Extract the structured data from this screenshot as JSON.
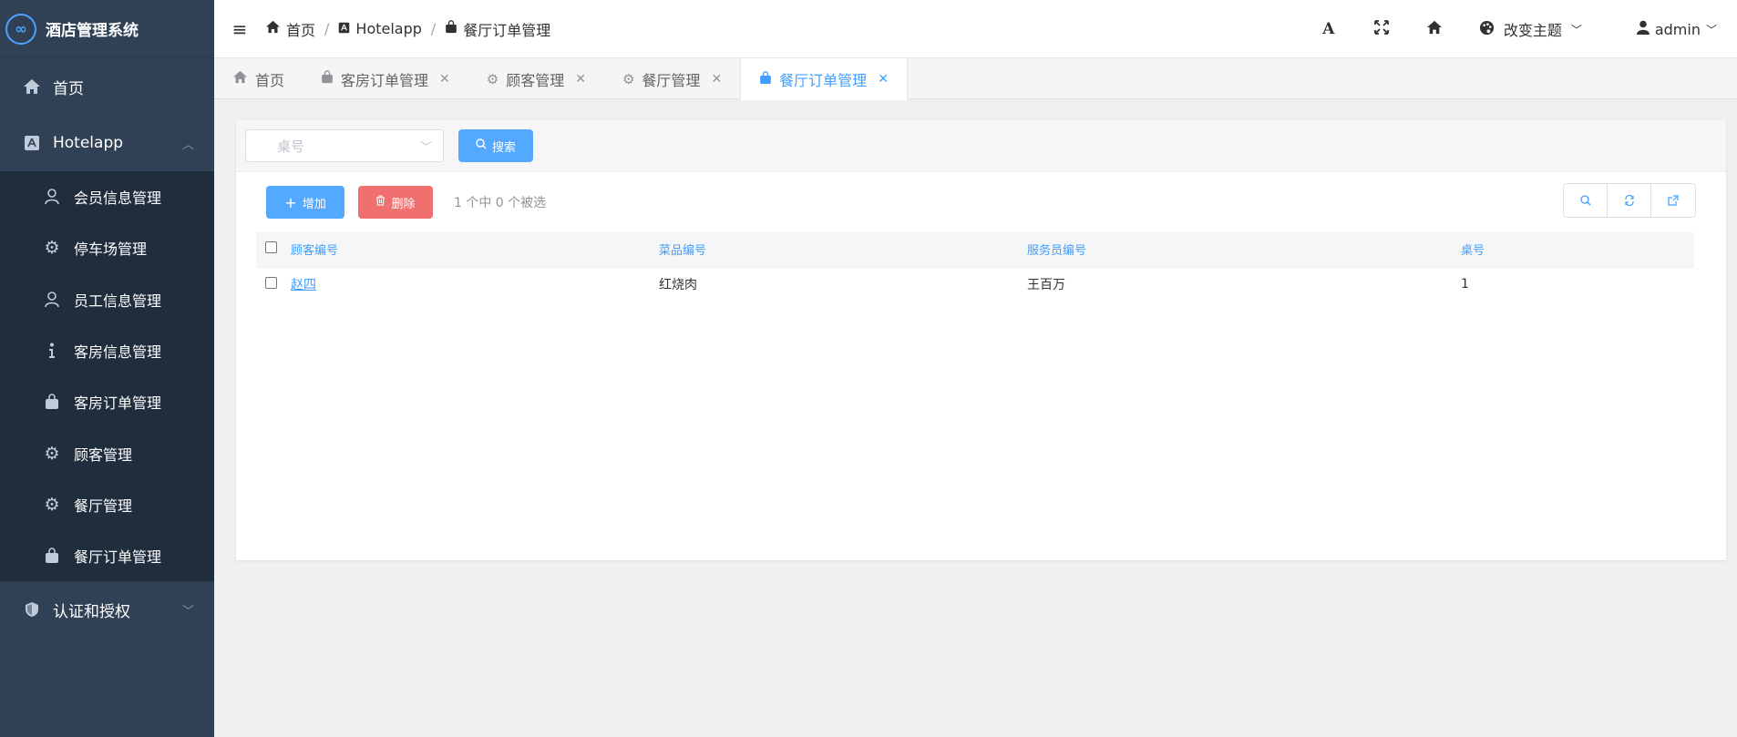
{
  "app": {
    "title": "酒店管理系统",
    "logo_glyph": "∞"
  },
  "sidebar": {
    "home": "首页",
    "group": "Hotelapp",
    "items": [
      {
        "label": "会员信息管理",
        "icon": "user-icon"
      },
      {
        "label": "停车场管理",
        "icon": "gear-icon"
      },
      {
        "label": "员工信息管理",
        "icon": "user-icon"
      },
      {
        "label": "客房信息管理",
        "icon": "info-icon"
      },
      {
        "label": "客房订单管理",
        "icon": "bag-icon"
      },
      {
        "label": "顾客管理",
        "icon": "gear-icon"
      },
      {
        "label": "餐厅管理",
        "icon": "gear-icon"
      },
      {
        "label": "餐厅订单管理",
        "icon": "bag-icon"
      }
    ],
    "auth": "认证和授权"
  },
  "breadcrumb": {
    "home": "首页",
    "app": "Hotelapp",
    "page": "餐厅订单管理",
    "separator": "/"
  },
  "header": {
    "theme": "改变主题",
    "user": "admin"
  },
  "tabs": [
    {
      "label": "首页",
      "icon": "home-icon",
      "closable": false
    },
    {
      "label": "客房订单管理",
      "icon": "bag-icon",
      "closable": true
    },
    {
      "label": "顾客管理",
      "icon": "gear-icon",
      "closable": true
    },
    {
      "label": "餐厅管理",
      "icon": "gear-icon",
      "closable": true
    },
    {
      "label": "餐厅订单管理",
      "icon": "bag-icon",
      "closable": true
    }
  ],
  "filter": {
    "placeholder": "桌号",
    "search_label": "搜索"
  },
  "actions": {
    "add_label": "增加",
    "delete_label": "删除",
    "selection_info": "1 个中 0 个被选"
  },
  "table": {
    "headers": [
      "顾客编号",
      "菜品编号",
      "服务员编号",
      "桌号"
    ],
    "rows": [
      [
        "赵四",
        "红烧肉",
        "王百万",
        "1"
      ]
    ]
  },
  "colors": {
    "accent": "#409eff",
    "danger": "#f07070",
    "sidebar": "#304156",
    "submenu": "#1f2d3d"
  }
}
